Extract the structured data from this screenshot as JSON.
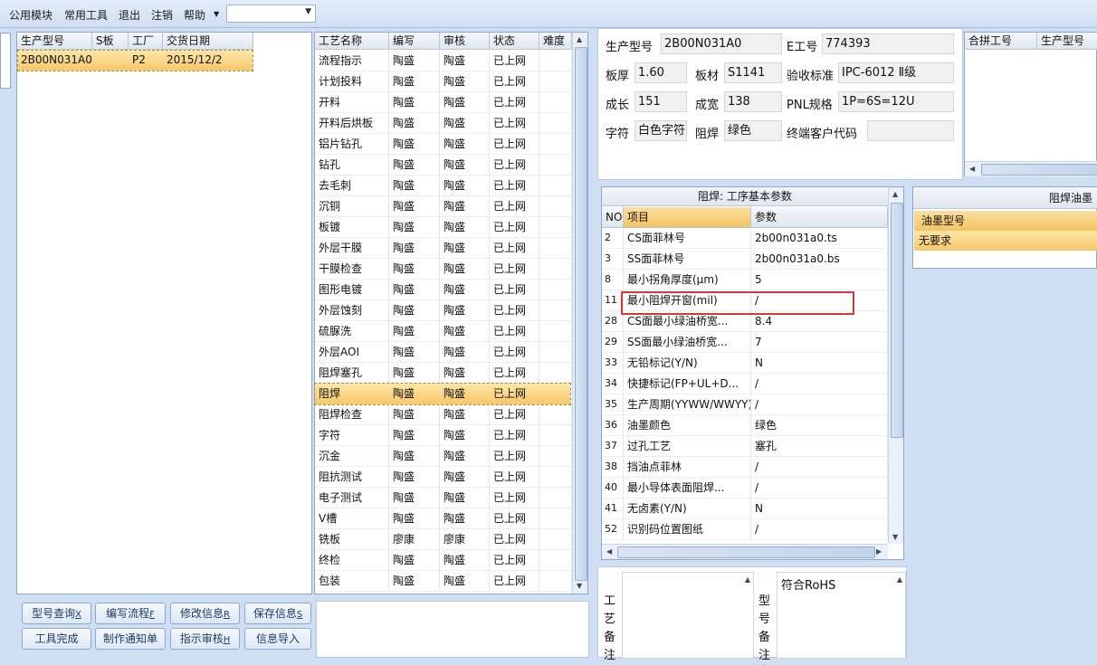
{
  "menu": {
    "items": [
      "公用模块",
      "常用工具",
      "退出",
      "注销",
      "帮助"
    ],
    "combo_value": ""
  },
  "product_list": {
    "headers": [
      "生产型号",
      "S板",
      "工厂",
      "交货日期"
    ],
    "rows": [
      [
        "2B00N031A0",
        "",
        "P2",
        "2015/12/2"
      ]
    ]
  },
  "process_list": {
    "headers": [
      "工艺名称",
      "编写",
      "审核",
      "状态",
      "难度"
    ],
    "rows": [
      [
        "流程指示",
        "陶盛",
        "陶盛",
        "已上网",
        ""
      ],
      [
        "计划投料",
        "陶盛",
        "陶盛",
        "已上网",
        ""
      ],
      [
        "开料",
        "陶盛",
        "陶盛",
        "已上网",
        ""
      ],
      [
        "开料后烘板",
        "陶盛",
        "陶盛",
        "已上网",
        ""
      ],
      [
        "铝片钻孔",
        "陶盛",
        "陶盛",
        "已上网",
        ""
      ],
      [
        "钻孔",
        "陶盛",
        "陶盛",
        "已上网",
        ""
      ],
      [
        "去毛刺",
        "陶盛",
        "陶盛",
        "已上网",
        ""
      ],
      [
        "沉铜",
        "陶盛",
        "陶盛",
        "已上网",
        ""
      ],
      [
        "板镀",
        "陶盛",
        "陶盛",
        "已上网",
        ""
      ],
      [
        "外层干膜",
        "陶盛",
        "陶盛",
        "已上网",
        ""
      ],
      [
        "干膜检查",
        "陶盛",
        "陶盛",
        "已上网",
        ""
      ],
      [
        "图形电镀",
        "陶盛",
        "陶盛",
        "已上网",
        ""
      ],
      [
        "外层蚀刻",
        "陶盛",
        "陶盛",
        "已上网",
        ""
      ],
      [
        "硫脲洗",
        "陶盛",
        "陶盛",
        "已上网",
        ""
      ],
      [
        "外层AOI",
        "陶盛",
        "陶盛",
        "已上网",
        ""
      ],
      [
        "阻焊塞孔",
        "陶盛",
        "陶盛",
        "已上网",
        ""
      ],
      [
        "阻焊",
        "陶盛",
        "陶盛",
        "已上网",
        ""
      ],
      [
        "阻焊检查",
        "陶盛",
        "陶盛",
        "已上网",
        ""
      ],
      [
        "字符",
        "陶盛",
        "陶盛",
        "已上网",
        ""
      ],
      [
        "沉金",
        "陶盛",
        "陶盛",
        "已上网",
        ""
      ],
      [
        "阻抗测试",
        "陶盛",
        "陶盛",
        "已上网",
        ""
      ],
      [
        "电子测试",
        "陶盛",
        "陶盛",
        "已上网",
        ""
      ],
      [
        "V槽",
        "陶盛",
        "陶盛",
        "已上网",
        ""
      ],
      [
        "铣板",
        "廖康",
        "廖康",
        "已上网",
        ""
      ],
      [
        "终检",
        "陶盛",
        "陶盛",
        "已上网",
        ""
      ],
      [
        "包装",
        "陶盛",
        "陶盛",
        "已上网",
        ""
      ]
    ],
    "selected_index": 16
  },
  "buttons": {
    "row1": [
      [
        "型号查询",
        "X"
      ],
      [
        "编写流程",
        "F"
      ],
      [
        "修改信息",
        "R"
      ],
      [
        "保存信息",
        "S"
      ]
    ],
    "row2": [
      [
        "工具完成",
        ""
      ],
      [
        "制作通知单",
        ""
      ],
      [
        "指示审核",
        "H"
      ],
      [
        "信息导入",
        ""
      ]
    ]
  },
  "info": {
    "model_label": "生产型号",
    "model": "2B00N031A0",
    "eno_label": "E工号",
    "eno": "774393",
    "thick_label": "板厚",
    "thick": "1.60",
    "mat_label": "板材",
    "mat": "S1141",
    "std_label": "验收标准",
    "std": "IPC-6012 Ⅱ级",
    "len_label": "成长",
    "len": "151",
    "wid_label": "成宽",
    "wid": "138",
    "pnl_label": "PNL规格",
    "pnl": "1P=6S=12U",
    "char_label": "字符",
    "char": "白色字符",
    "mask_label": "阻焊",
    "mask": "绿色",
    "cust_label": "终端客户代码",
    "cust": ""
  },
  "merge_list": {
    "headers": [
      "合拼工号",
      "生产型号"
    ]
  },
  "params": {
    "title": "阻焊: 工序基本参数",
    "headers": [
      "NO",
      "项目",
      "参数"
    ],
    "rows": [
      [
        "2",
        "CS面菲林号",
        "2b00n031a0.ts"
      ],
      [
        "3",
        "SS面菲林号",
        "2b00n031a0.bs"
      ],
      [
        "8",
        "最小拐角厚度(μm)",
        "5"
      ],
      [
        "11",
        "最小阻焊开窗(mil)",
        "/"
      ],
      [
        "28",
        "CS面最小绿油桥宽...",
        "8.4"
      ],
      [
        "29",
        "SS面最小绿油桥宽...",
        "7"
      ],
      [
        "33",
        "无铅标记(Y/N)",
        "N"
      ],
      [
        "34",
        "快捷标记(FP+UL+D...",
        "/"
      ],
      [
        "35",
        "生产周期(YYWW/WWYY)",
        "/"
      ],
      [
        "36",
        "油墨颜色",
        "绿色"
      ],
      [
        "37",
        "过孔工艺",
        "塞孔"
      ],
      [
        "38",
        "挡油点菲林",
        "/"
      ],
      [
        "40",
        "最小导体表面阻焊...",
        "/"
      ],
      [
        "41",
        "无卤素(Y/N)",
        "N"
      ],
      [
        "52",
        "识别码位置图纸",
        "/"
      ]
    ]
  },
  "ink": {
    "title": "阻焊油墨",
    "header": "油墨型号",
    "row": "无要求"
  },
  "notes": {
    "process_label": "工艺备注",
    "model_label": "型号备注",
    "model_note": "符合RoHS"
  }
}
